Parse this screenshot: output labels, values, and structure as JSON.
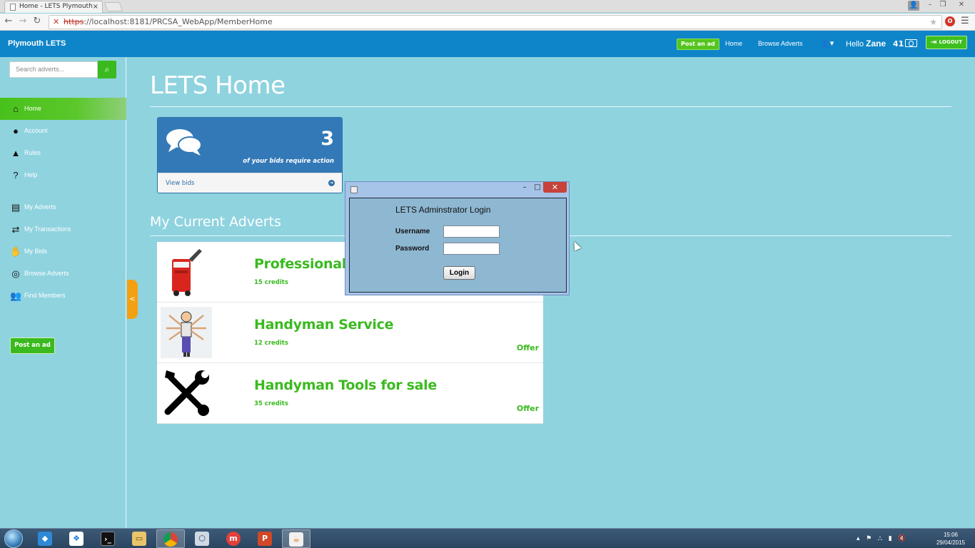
{
  "browser": {
    "tab_title": "Home - LETS Plymouth",
    "tab_close": "×",
    "url_protocol": "https",
    "url_rest": "://localhost:8181/PRCSA_WebApp/MemberHome",
    "back": "←",
    "forward": "→",
    "reload": "↻",
    "window_min": "–",
    "window_restore": "❐",
    "window_close": "✕"
  },
  "navbar": {
    "brand": "Plymouth LETS",
    "post_ad": "Post an ad",
    "home": "Home",
    "browse": "Browse Adverts",
    "user_menu": "👤▾",
    "hello": "Hello",
    "username": "Zane",
    "credits": "41",
    "logout": "LOGOUT"
  },
  "sidebar": {
    "search_placeholder": "Search adverts...",
    "items": [
      {
        "label": "Home",
        "icon": "⌂"
      },
      {
        "label": "Account",
        "icon": "●"
      },
      {
        "label": "Rules",
        "icon": "▲"
      },
      {
        "label": "Help",
        "icon": "?"
      },
      {
        "label": "My Adverts",
        "icon": "▤"
      },
      {
        "label": "My Transactions",
        "icon": "⇄"
      },
      {
        "label": "My Bids",
        "icon": "✋"
      },
      {
        "label": "Browse Adverts",
        "icon": "◎"
      },
      {
        "label": "Find Members",
        "icon": "👥"
      }
    ],
    "post_ad": "Post an ad",
    "collapse": "<"
  },
  "main": {
    "title": "LETS Home",
    "bids_count": "3",
    "bids_text": "of your bids require action",
    "view_bids": "View bids",
    "section_title": "My Current Adverts",
    "adverts": [
      {
        "title": "Professional F",
        "credits": "15 credits",
        "type": ""
      },
      {
        "title": "Handyman Service",
        "credits": "12 credits",
        "type": "Offer"
      },
      {
        "title": "Handyman Tools for sale",
        "credits": "35 credits",
        "type": "Offer"
      }
    ]
  },
  "dialog": {
    "min": "–",
    "max": "□",
    "close": "✕",
    "heading": "LETS Adminstrator Login",
    "username_label": "Username",
    "password_label": "Password",
    "username_value": "",
    "password_value": "",
    "login": "Login"
  },
  "taskbar": {
    "time": "15:06",
    "date": "29/04/2015"
  },
  "colors": {
    "navbar": "#0f85c9",
    "background": "#8fd3df",
    "accent_green": "#3aba1f",
    "panel_blue": "#3379b7",
    "dialog_bg": "#8eb7d2"
  }
}
